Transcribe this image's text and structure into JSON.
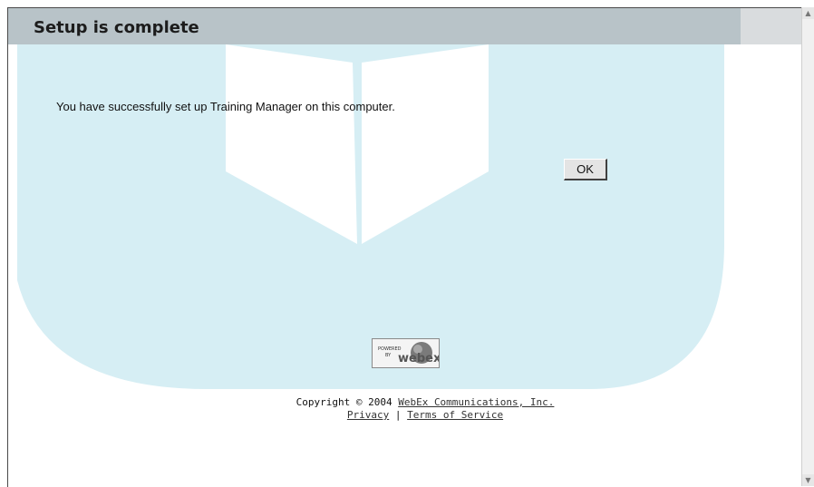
{
  "header": {
    "title": "Setup is complete"
  },
  "main": {
    "message": "You have successfully set up Training Manager on this computer.",
    "ok_label": "OK"
  },
  "footer": {
    "copyright_prefix": "Copyright © 2004",
    "company_link": "WebEx Communications, Inc.",
    "privacy_link": "Privacy",
    "separator": "|",
    "terms_link": "Terms of Service"
  },
  "logo": {
    "line1": "POWERED",
    "line2": "BY",
    "brand": "webex"
  },
  "colors": {
    "title_bar": "#b8c3c8",
    "watermark": "#d6eef4"
  }
}
